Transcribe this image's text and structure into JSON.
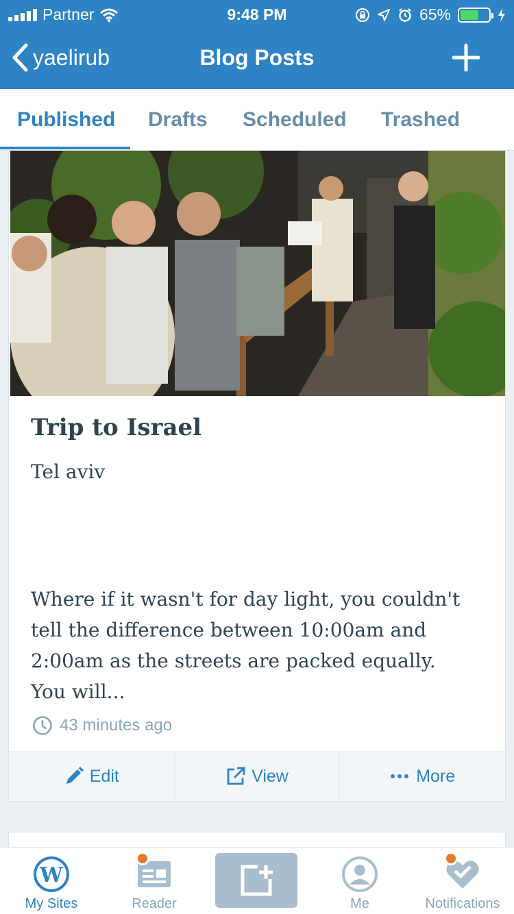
{
  "status_bar": {
    "carrier": "Partner",
    "time": "9:48 PM",
    "battery_percent": "65%",
    "battery_level": 0.65,
    "icons": [
      "signal-icon",
      "wifi-icon",
      "orientation-lock-icon",
      "location-icon",
      "alarm-icon",
      "battery-icon",
      "charging-icon"
    ]
  },
  "nav": {
    "back_label": "yaelirub",
    "title": "Blog Posts",
    "add_icon": "plus-icon"
  },
  "tabs": [
    {
      "label": "Published",
      "active": true
    },
    {
      "label": "Drafts",
      "active": false
    },
    {
      "label": "Scheduled",
      "active": false
    },
    {
      "label": "Trashed",
      "active": false
    }
  ],
  "post": {
    "title": "Trip to Israel",
    "subtitle": "Tel aviv",
    "excerpt": "Where if it wasn't for day light, you couldn't tell the difference between 10:00am and 2:00am as the streets are packed equally. You will...",
    "time_ago": "43 minutes ago",
    "actions": {
      "edit": "Edit",
      "view": "View",
      "more": "More"
    }
  },
  "tab_bar": {
    "items": [
      {
        "label": "My Sites",
        "icon": "wordpress-icon",
        "active": true
      },
      {
        "label": "Reader",
        "icon": "reader-icon",
        "badge": true
      },
      {
        "label": "",
        "icon": "write-post-icon"
      },
      {
        "label": "Me",
        "icon": "me-icon"
      },
      {
        "label": "Notifications",
        "icon": "notifications-icon",
        "badge": true
      }
    ]
  },
  "colors": {
    "brand_blue": "#2e83c4",
    "text_dark": "#2e4453",
    "text_muted": "#87a6bc",
    "badge_orange": "#e87a2e",
    "background": "#e9eff3"
  }
}
